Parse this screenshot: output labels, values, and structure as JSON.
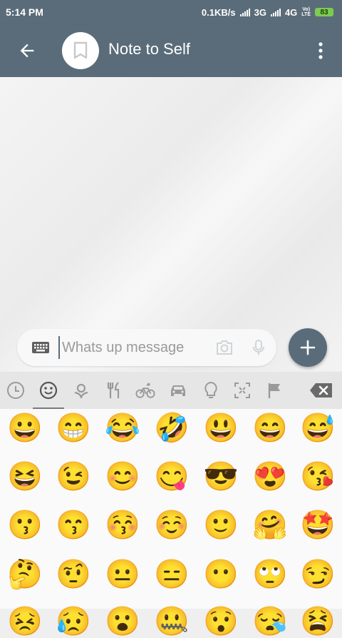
{
  "status_bar": {
    "time": "5:14 PM",
    "speed": "0.1KB/s",
    "net1": "3G",
    "net2": "4G",
    "volte": "Vo)",
    "lte": "LTE",
    "battery": "83"
  },
  "header": {
    "title": "Note to Self",
    "back_icon": "arrow-left-icon",
    "avatar_icon": "bookmark-icon",
    "menu_icon": "more-vert-icon"
  },
  "composer": {
    "placeholder": "Whats up message",
    "value": "",
    "fab_icon": "plus-icon"
  },
  "emoji_categories": [
    {
      "icon": "recent-clock-icon",
      "active": false
    },
    {
      "icon": "smiley-icon",
      "active": true
    },
    {
      "icon": "nature-flower-icon",
      "active": false
    },
    {
      "icon": "food-fork-knife-icon",
      "active": false
    },
    {
      "icon": "activity-bicycle-icon",
      "active": false
    },
    {
      "icon": "travel-car-icon",
      "active": false
    },
    {
      "icon": "objects-bulb-icon",
      "active": false
    },
    {
      "icon": "symbols-expand-icon",
      "active": false
    },
    {
      "icon": "flags-flag-icon",
      "active": false
    }
  ],
  "emoji_rows": [
    [
      "😀",
      "😁",
      "😂",
      "🤣",
      "😃",
      "😄",
      "😅"
    ],
    [
      "😆",
      "😉",
      "😊",
      "😋",
      "😎",
      "😍",
      "😘"
    ],
    [
      "😗",
      "😙",
      "😚",
      "☺️",
      "🙂",
      "🤗",
      "🤩"
    ],
    [
      "🤔",
      "🤨",
      "😐",
      "😑",
      "😶",
      "🙄",
      "😏"
    ],
    [
      "😣",
      "😥",
      "😮",
      "🤐",
      "😯",
      "😪",
      "😫"
    ]
  ],
  "colors": {
    "primary": "#5a6c79",
    "battery": "#7ccc4f"
  }
}
